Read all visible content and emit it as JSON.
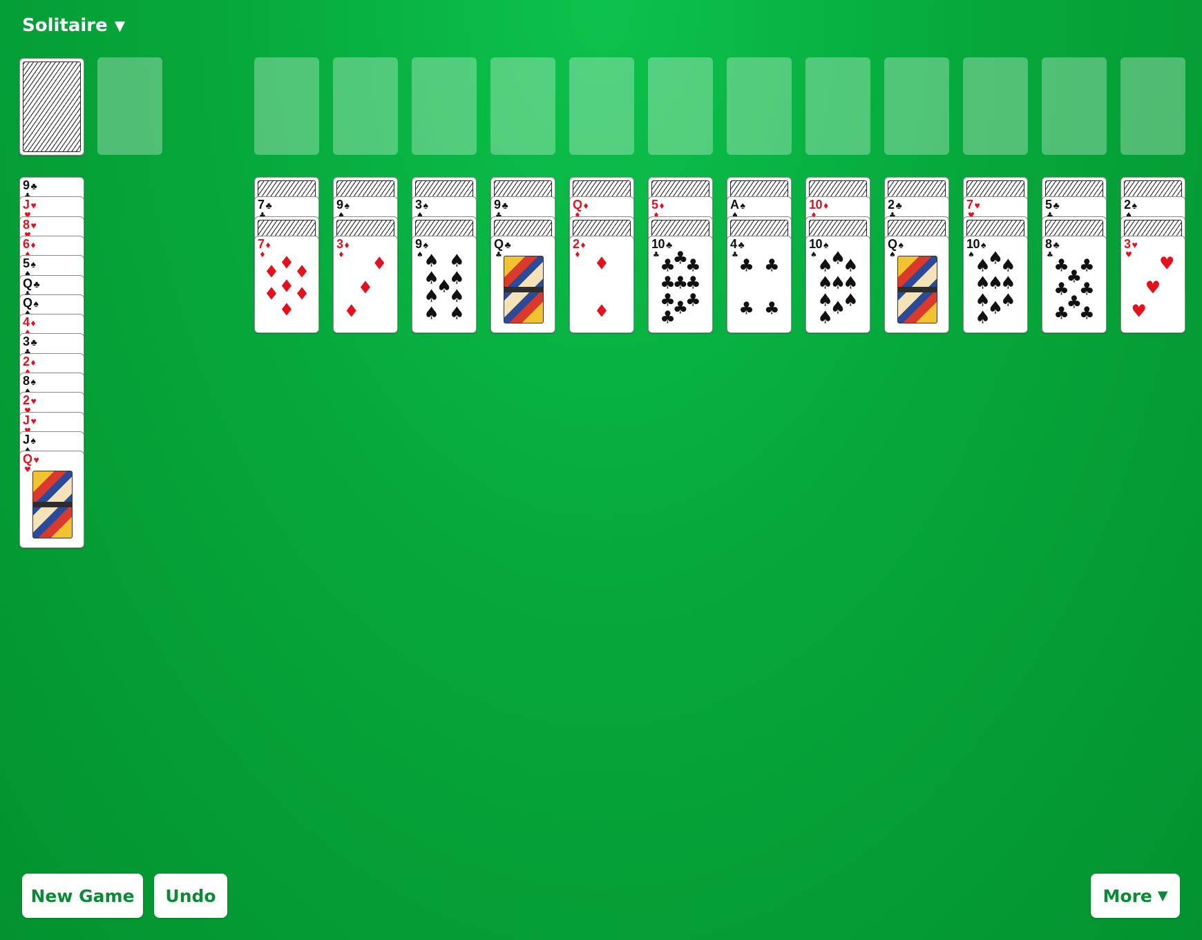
{
  "header": {
    "title": "Solitaire"
  },
  "buttons": {
    "new_game": "New Game",
    "undo": "Undo",
    "more": "More"
  },
  "colors": {
    "table_green": "#06a83b",
    "red_suit": "#e4111c",
    "button_text": "#0a8a35"
  },
  "left_pile": [
    {
      "rank": "9",
      "suit": "♣",
      "color": "black"
    },
    {
      "rank": "J",
      "suit": "♥",
      "color": "red"
    },
    {
      "rank": "8",
      "suit": "♥",
      "color": "red"
    },
    {
      "rank": "6",
      "suit": "♦",
      "color": "red"
    },
    {
      "rank": "5",
      "suit": "♠",
      "color": "black"
    },
    {
      "rank": "Q",
      "suit": "♣",
      "color": "black"
    },
    {
      "rank": "Q",
      "suit": "♠",
      "color": "black"
    },
    {
      "rank": "4",
      "suit": "♦",
      "color": "red"
    },
    {
      "rank": "3",
      "suit": "♣",
      "color": "black"
    },
    {
      "rank": "2",
      "suit": "♦",
      "color": "red"
    },
    {
      "rank": "8",
      "suit": "♠",
      "color": "black"
    },
    {
      "rank": "2",
      "suit": "♥",
      "color": "red"
    },
    {
      "rank": "J",
      "suit": "♥",
      "color": "red"
    },
    {
      "rank": "J",
      "suit": "♠",
      "color": "black"
    },
    {
      "rank": "Q",
      "suit": "♥",
      "color": "red"
    }
  ],
  "columns": [
    {
      "mid": {
        "rank": "7",
        "suit": "♣",
        "color": "black"
      },
      "top": {
        "rank": "7",
        "suit": "♦",
        "color": "red"
      }
    },
    {
      "mid": {
        "rank": "9",
        "suit": "♠",
        "color": "black"
      },
      "top": {
        "rank": "3",
        "suit": "♦",
        "color": "red"
      }
    },
    {
      "mid": {
        "rank": "3",
        "suit": "♠",
        "color": "black"
      },
      "top": {
        "rank": "9",
        "suit": "♠",
        "color": "black"
      }
    },
    {
      "mid": {
        "rank": "9",
        "suit": "♣",
        "color": "black"
      },
      "top": {
        "rank": "Q",
        "suit": "♣",
        "color": "black"
      }
    },
    {
      "mid": {
        "rank": "Q",
        "suit": "♦",
        "color": "red"
      },
      "top": {
        "rank": "2",
        "suit": "♦",
        "color": "red"
      }
    },
    {
      "mid": {
        "rank": "5",
        "suit": "♦",
        "color": "red"
      },
      "top": {
        "rank": "10",
        "suit": "♣",
        "color": "black"
      }
    },
    {
      "mid": {
        "rank": "A",
        "suit": "♠",
        "color": "black"
      },
      "top": {
        "rank": "4",
        "suit": "♣",
        "color": "black"
      }
    },
    {
      "mid": {
        "rank": "10",
        "suit": "♦",
        "color": "red"
      },
      "top": {
        "rank": "10",
        "suit": "♠",
        "color": "black"
      }
    },
    {
      "mid": {
        "rank": "2",
        "suit": "♣",
        "color": "black"
      },
      "top": {
        "rank": "Q",
        "suit": "♠",
        "color": "black"
      }
    },
    {
      "mid": {
        "rank": "7",
        "suit": "♥",
        "color": "red"
      },
      "top": {
        "rank": "10",
        "suit": "♠",
        "color": "black"
      }
    },
    {
      "mid": {
        "rank": "5",
        "suit": "♣",
        "color": "black"
      },
      "top": {
        "rank": "8",
        "suit": "♣",
        "color": "black"
      }
    },
    {
      "mid": {
        "rank": "2",
        "suit": "♠",
        "color": "black"
      },
      "top": {
        "rank": "3",
        "suit": "♥",
        "color": "red"
      }
    }
  ]
}
